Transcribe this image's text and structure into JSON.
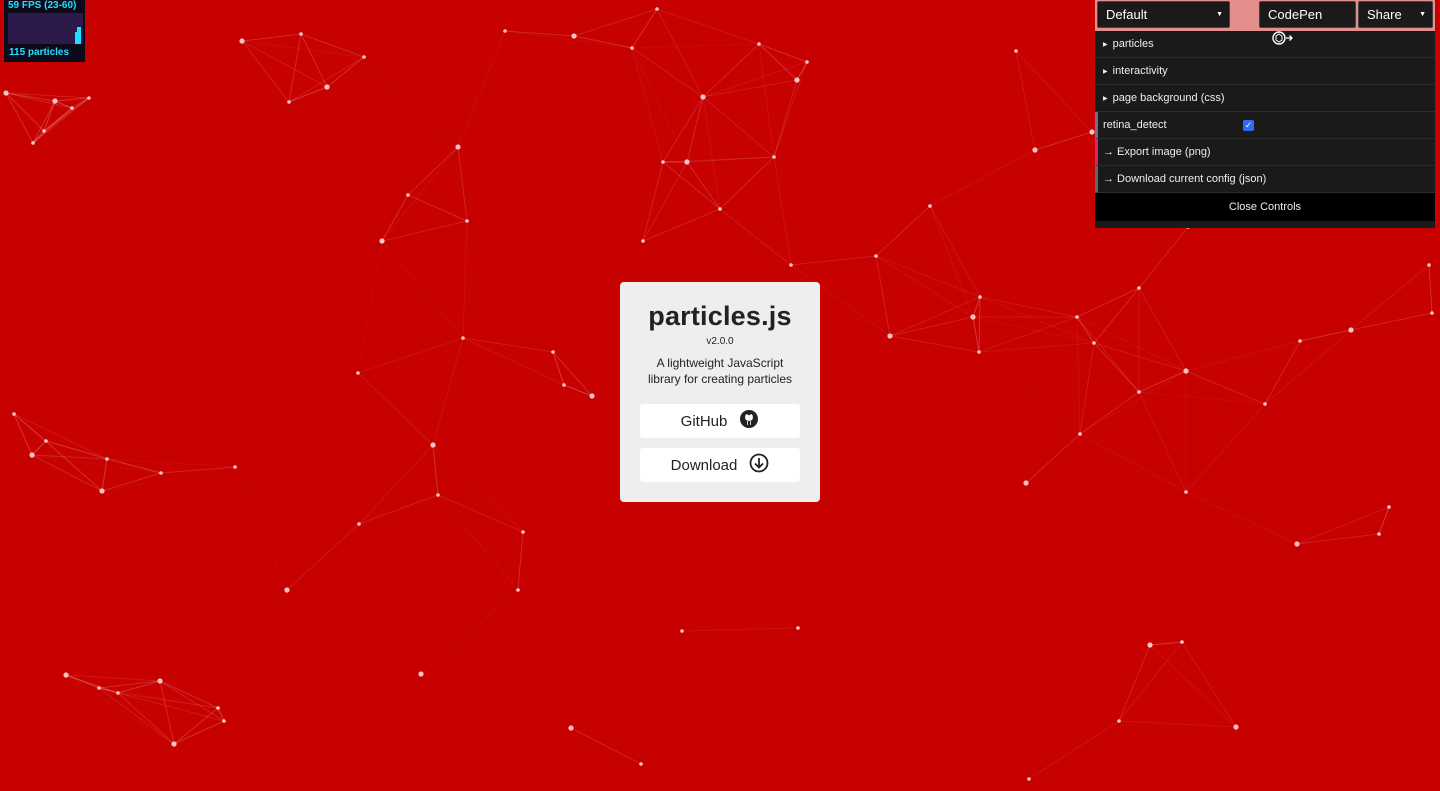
{
  "stats": {
    "fps": "59 FPS (23-60)",
    "particles": "115 particles"
  },
  "card": {
    "title": "particles.js",
    "version": "v2.0.0",
    "description": "A lightweight JavaScript library for creating particles",
    "github_label": "GitHub",
    "download_label": "Download"
  },
  "controls": {
    "preset": "Default",
    "codepen_label": "CodePen",
    "share_label": "Share",
    "folders": [
      "particles",
      "interactivity",
      "page background (css)"
    ],
    "retina_detect_label": "retina_detect",
    "retina_detect_checked": true,
    "export_label": "→ Export image (png)",
    "download_config_label": "→ Download current config (json)",
    "close_label": "Close Controls"
  },
  "colors": {
    "background": "#c70000",
    "card": "#eeeeee",
    "panel": "#1a1a1a",
    "stats_text": "#20e0ff",
    "checkbox": "#2e6bf6"
  }
}
